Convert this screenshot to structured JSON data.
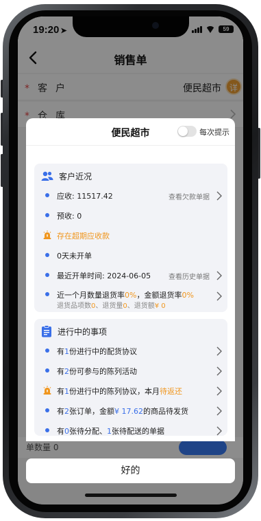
{
  "status_bar": {
    "time": "19:20",
    "battery": "59"
  },
  "header": {
    "title": "销售单"
  },
  "form": {
    "customer": {
      "label": "客户",
      "value": "便民超市",
      "detail_badge": "详"
    },
    "warehouse": {
      "label": "仓库"
    }
  },
  "behind_bottom_text": "单数量 0",
  "modal": {
    "title": "便民超市",
    "toggle_label": "每次提示",
    "toggle_on": false,
    "customer_section": {
      "title": "客户近况",
      "receivable": "应收: 11517.42",
      "receivable_link": "查看欠款单据",
      "prepaid": "预收: 0",
      "overdue_warning": "存在超期应收款",
      "days_no_order": "0天未开单",
      "last_order": "最近开单时间: 2024-06-05",
      "last_order_link": "查看历史单据",
      "return_rate": {
        "prefix": "近一个月数量退货率",
        "qty_rate": "0%",
        "mid": "，金额退货率",
        "amount_rate": "0%",
        "sub_a": "退货品项数",
        "sub_a_val": "0",
        "sub_b": "、退货量",
        "sub_b_val": "0",
        "sub_c": "、退货额",
        "sub_c_val": "¥ 0"
      }
    },
    "ongoing_section": {
      "title": "进行中的事项",
      "item1": {
        "a": "有",
        "n": "1",
        "b": "份进行中的配货协议"
      },
      "item2": {
        "a": "有",
        "n": "2",
        "b": "份可参与的陈列活动"
      },
      "item3": {
        "a": "有",
        "n": "1",
        "b": "份进行中的陈列协议，本月",
        "c": "待返还"
      },
      "item4": {
        "a": "有",
        "n": "2",
        "b": "张订单，金额",
        "amount": "¥ 17.62",
        "c": "的商品待发货"
      },
      "item5": {
        "a": "有",
        "n": "0",
        "b": "张待分配、",
        "m": "1",
        "c": "张待配送的单据"
      }
    }
  },
  "ok_button": "好的",
  "colors": {
    "accent_blue": "#3a6fe8",
    "accent_orange": "#f0961e",
    "badge_orange": "#f0a033"
  }
}
